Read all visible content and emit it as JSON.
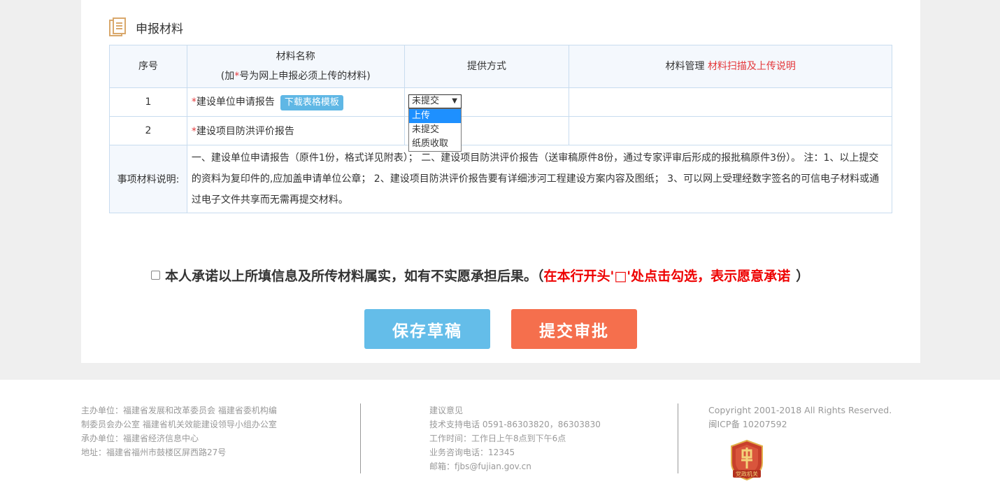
{
  "section": {
    "title": "申报材料"
  },
  "table": {
    "headers": {
      "index": "序号",
      "name_line1": "材料名称",
      "name_line2_prefix": "(加",
      "name_line2_star": "*",
      "name_line2_suffix": "号为网上申报必须上传的材料)",
      "provide": "提供方式",
      "manage": "材料管理",
      "manage_link": "材料扫描及上传说明"
    },
    "rows": [
      {
        "index": "1",
        "star": "*",
        "name": "建设单位申请报告",
        "template_btn": "下载表格模板"
      },
      {
        "index": "2",
        "star": "*",
        "name": "建设项目防洪评价报告"
      }
    ],
    "desc_label": "事项材料说明:",
    "desc_text": "一、建设单位申请报告（原件1份，格式详见附表）；  二、建设项目防洪评价报告（送审稿原件8份，通过专家评审后形成的报批稿原件3份）。 注：1、以上提交的资料为复印件的,应加盖申请单位公章； 2、建设项目防洪评价报告要有详细涉河工程建设方案内容及图纸； 3、可以网上受理经数字签名的可信电子材料或通过电子文件共享而无需再提交材料。"
  },
  "select": {
    "value": "未提交",
    "options": [
      "上传",
      "未提交",
      "纸质收取"
    ],
    "highlighted": "上传"
  },
  "promise": {
    "text": "本人承诺以上所填信息及所传材料属实，如有不实愿承担后果。（",
    "red": "在本行开头'□'处点击勾选，表示愿意承诺",
    "close": "）"
  },
  "buttons": {
    "save": "保存草稿",
    "submit": "提交审批"
  },
  "footer": {
    "col1": [
      "主办单位：福建省发展和改革委员会 福建省委机构编",
      "制委员会办公室 福建省机关效能建设领导小组办公室",
      "承办单位：福建省经济信息中心",
      "地址：福建省福州市鼓楼区屏西路27号"
    ],
    "col2": [
      "建议意见",
      "技术支持电话 0591-86303820，86303830",
      "工作时间：工作日上午8点到下午6点",
      "业务咨询电话：12345",
      "邮箱：fjbs@fujian.gov.cn"
    ],
    "col3": [
      "Copyright 2001-2018 All Rights Reserved.",
      "闽ICP备 10207592"
    ],
    "emblem_text": "党政机关"
  },
  "colors": {
    "accent_blue": "#64bde9",
    "accent_orange": "#f56f4d",
    "required_red": "#e4393c"
  }
}
